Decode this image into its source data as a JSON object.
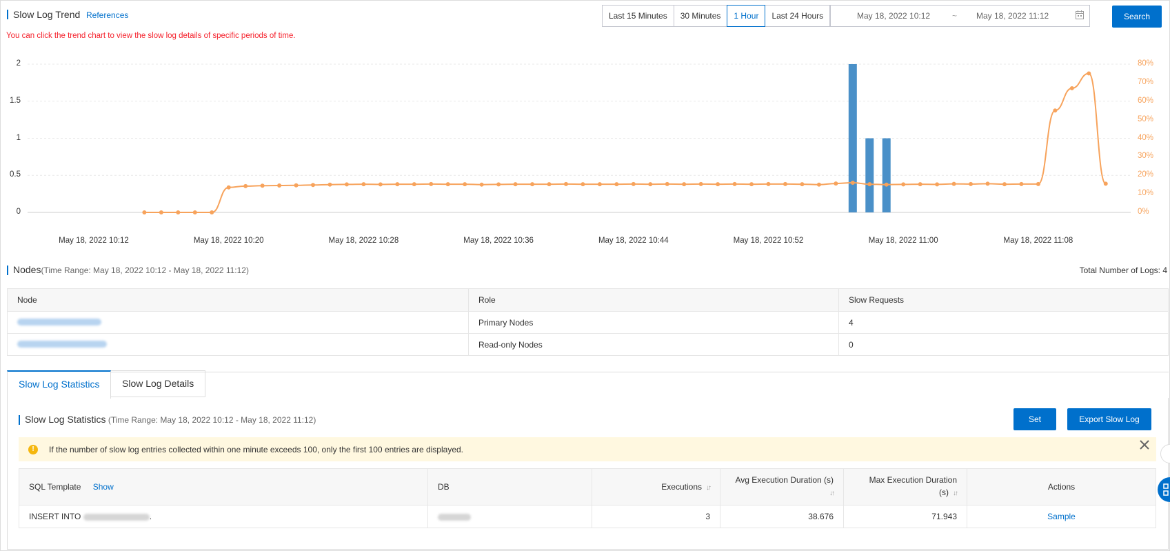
{
  "header": {
    "title": "Slow Log Trend",
    "references_link": "References",
    "hint": "You can click the trend chart to view the slow log details of specific periods of time.",
    "time_buttons": [
      "Last 15 Minutes",
      "30 Minutes",
      "1 Hour",
      "Last 24 Hours"
    ],
    "active_time_button": "1 Hour",
    "range_start": "May 18, 2022 10:12",
    "range_separator": "~",
    "range_end": "May 18, 2022 11:12",
    "search_label": "Search"
  },
  "chart_data": {
    "type": "bar+line",
    "x_tick_labels": [
      "May 18, 2022 10:12",
      "May 18, 2022 10:20",
      "May 18, 2022 10:28",
      "May 18, 2022 10:36",
      "May 18, 2022 10:44",
      "May 18, 2022 10:52",
      "May 18, 2022 11:00",
      "May 18, 2022 11:08"
    ],
    "left_axis": {
      "ticks": [
        "0",
        "0.5",
        "1",
        "1.5",
        "2"
      ],
      "ylim": [
        0,
        2
      ]
    },
    "right_axis": {
      "ticks": [
        "0%",
        "10%",
        "20%",
        "30%",
        "40%",
        "50%",
        "60%",
        "70%",
        "80%"
      ],
      "ylim": [
        0,
        80
      ]
    },
    "grid": true,
    "bars": {
      "color": "#4a90c8",
      "x_minutes": [
        57,
        58,
        59
      ],
      "values": [
        2,
        1,
        1
      ]
    },
    "line": {
      "color": "#f7a35c",
      "x_minutes": [
        15,
        16,
        17,
        18,
        19,
        20,
        21,
        22,
        23,
        24,
        25,
        26,
        27,
        28,
        29,
        30,
        31,
        32,
        33,
        34,
        35,
        36,
        37,
        38,
        39,
        40,
        41,
        42,
        43,
        44,
        45,
        46,
        47,
        48,
        49,
        50,
        51,
        52,
        53,
        54,
        55,
        56,
        57,
        58,
        59,
        60,
        61,
        62,
        63,
        64,
        65,
        66,
        67,
        68,
        69,
        70,
        71,
        72
      ],
      "values": [
        0,
        0,
        0,
        0,
        0,
        13.5,
        14.2,
        14.4,
        14.5,
        14.6,
        14.8,
        15.0,
        15.1,
        15.2,
        15.1,
        15.2,
        15.2,
        15.3,
        15.2,
        15.2,
        15.0,
        15.1,
        15.2,
        15.2,
        15.2,
        15.3,
        15.2,
        15.2,
        15.2,
        15.3,
        15.2,
        15.3,
        15.2,
        15.3,
        15.2,
        15.3,
        15.2,
        15.3,
        15.3,
        15.2,
        15.0,
        15.6,
        16.0,
        15.2,
        15.0,
        15.1,
        15.2,
        15.1,
        15.4,
        15.3,
        15.5,
        15.2,
        15.3,
        15.3,
        55,
        67,
        75,
        15.5
      ]
    }
  },
  "nodes": {
    "title": "Nodes",
    "time_range": "(Time Range: May 18, 2022 10:12 - May 18, 2022 11:12)",
    "total_logs": "Total Number of Logs: 4",
    "columns": [
      "Node",
      "Role",
      "Slow Requests"
    ],
    "rows": [
      {
        "role": "Primary Nodes",
        "slow_requests": "4"
      },
      {
        "role": "Read-only Nodes",
        "slow_requests": "0"
      }
    ]
  },
  "tabs": [
    "Slow Log Statistics",
    "Slow Log Details"
  ],
  "active_tab": "Slow Log Statistics",
  "stats": {
    "title": "Slow Log Statistics",
    "time_range": "(Time Range: May 18, 2022 10:12 - May 18, 2022 11:12)",
    "set_label": "Set",
    "export_label": "Export Slow Log",
    "notice": "If the number of slow log entries collected within one minute exceeds 100, only the first 100 entries are displayed.",
    "columns": {
      "sql_template": "SQL Template",
      "show": "Show",
      "db": "DB",
      "executions": "Executions",
      "avg_duration": "Avg Execution Duration (s)",
      "max_duration_line1": "Max Execution Duration",
      "max_duration_line2": "(s)",
      "actions": "Actions"
    },
    "row": {
      "sql_prefix": "INSERT INTO",
      "sql_suffix": ".",
      "executions": "3",
      "avg_duration": "38.676",
      "max_duration": "71.943",
      "action": "Sample"
    }
  }
}
